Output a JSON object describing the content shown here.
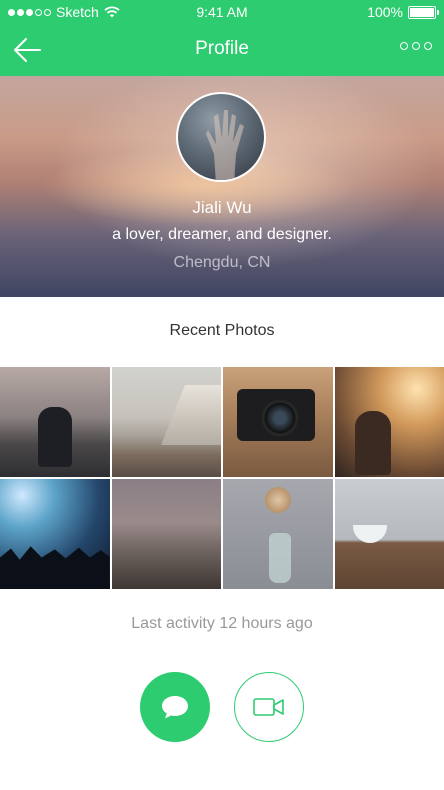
{
  "status_bar": {
    "carrier": "Sketch",
    "time": "9:41 AM",
    "battery": "100%",
    "signal_bars": 3,
    "signal_total": 5
  },
  "nav": {
    "title": "Profile",
    "back_icon": "arrow-left-icon",
    "more_icon": "more-dots-icon"
  },
  "profile": {
    "name": "Jiali Wu",
    "tagline": "a lover, dreamer, and designer.",
    "location": "Chengdu, CN"
  },
  "photos": {
    "section_title": "Recent Photos",
    "items": [
      "photo-1",
      "photo-2",
      "photo-3",
      "photo-4",
      "photo-5",
      "photo-6",
      "photo-7",
      "photo-8"
    ]
  },
  "activity": {
    "text": "Last activity 12 hours ago"
  },
  "actions": {
    "message_icon": "chat-bubble-icon",
    "video_icon": "video-camera-icon"
  },
  "colors": {
    "accent": "#2ecc71",
    "muted_text": "#999999"
  }
}
